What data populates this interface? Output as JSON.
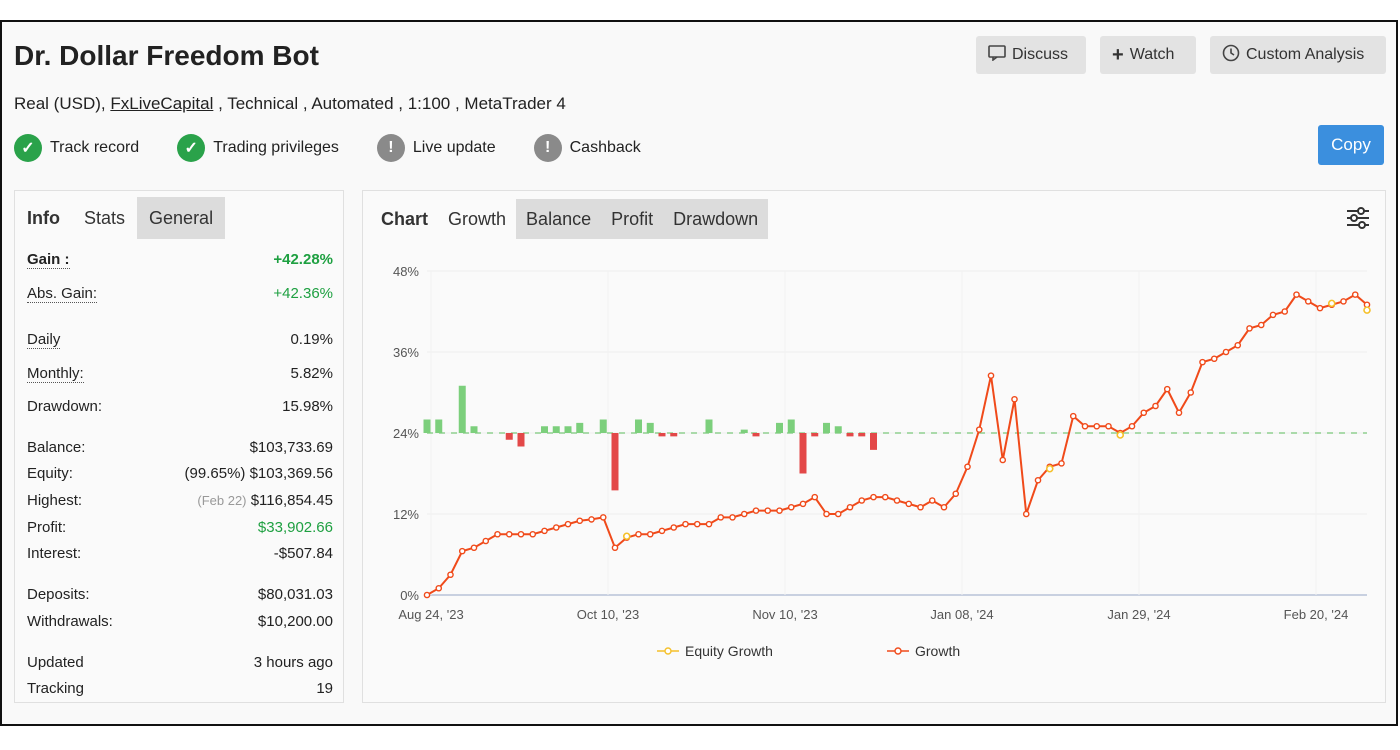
{
  "header": {
    "title": "Dr. Dollar Freedom Bot",
    "subtitle_prefix": "Real (USD), ",
    "subtitle_link": "FxLiveCapital",
    "subtitle_suffix": " , Technical , Automated , 1:100 , MetaTrader 4",
    "buttons": {
      "discuss": "Discuss",
      "watch": "Watch",
      "custom_analysis": "Custom Analysis",
      "copy": "Copy"
    }
  },
  "badges": [
    {
      "label": "Track record",
      "status": "ok"
    },
    {
      "label": "Trading privileges",
      "status": "ok"
    },
    {
      "label": "Live update",
      "status": "warn"
    },
    {
      "label": "Cashback",
      "status": "warn"
    }
  ],
  "left_panel": {
    "tabs": [
      "Info",
      "Stats",
      "General"
    ],
    "gain": {
      "label": "Gain :",
      "value": "+42.28%"
    },
    "abs_gain": {
      "label": "Abs. Gain:",
      "value": "+42.36%"
    },
    "daily": {
      "label": "Daily",
      "value": "0.19%"
    },
    "monthly": {
      "label": "Monthly:",
      "value": "5.82%"
    },
    "drawdown": {
      "label": "Drawdown:",
      "value": "15.98%"
    },
    "balance": {
      "label": "Balance:",
      "value": "$103,733.69"
    },
    "equity": {
      "label": "Equity:",
      "pct": "(99.65%)",
      "value": "$103,369.56"
    },
    "highest": {
      "label": "Highest:",
      "date": "(Feb 22)",
      "value": "$116,854.45"
    },
    "profit": {
      "label": "Profit:",
      "value": "$33,902.66"
    },
    "interest": {
      "label": "Interest:",
      "value": "-$507.84"
    },
    "deposits": {
      "label": "Deposits:",
      "value": "$80,031.03"
    },
    "withdrawals": {
      "label": "Withdrawals:",
      "value": "$10,200.00"
    },
    "updated": {
      "label": "Updated",
      "value": "3 hours ago"
    },
    "tracking": {
      "label": "Tracking",
      "value": "19"
    }
  },
  "chart_panel": {
    "tabs": [
      "Chart",
      "Growth",
      "Balance",
      "Profit",
      "Drawdown"
    ]
  },
  "colors": {
    "growth": "#f04a1a",
    "equity": "#f5c02a",
    "bar_pos": "#7ccf7c",
    "bar_neg": "#e34848",
    "copy": "#3b8fde",
    "green_text": "#1ea041"
  },
  "chart_data": {
    "type": "line",
    "ylim": [
      0,
      48
    ],
    "yticks": [
      "0%",
      "12%",
      "24%",
      "36%",
      "48%"
    ],
    "xticks": [
      "Aug 24, '23",
      "Oct 10, '23",
      "Nov 10, '23",
      "Jan 08, '24",
      "Jan 29, '24",
      "Feb 20, '24"
    ],
    "legend": [
      "Equity Growth",
      "Growth"
    ],
    "growth": [
      0,
      1,
      3,
      6.5,
      7,
      8,
      9,
      9,
      9,
      9,
      9.5,
      10,
      10.5,
      11,
      11.2,
      11.5,
      7,
      8.5,
      9,
      9,
      9.5,
      10,
      10.5,
      10.5,
      10.5,
      11.5,
      11.5,
      12,
      12.5,
      12.5,
      12.5,
      13,
      13.5,
      14.5,
      12,
      12,
      13,
      14,
      14.5,
      14.5,
      14,
      13.5,
      13,
      14,
      13,
      15,
      19,
      24.5,
      32.5,
      20,
      29,
      12,
      17,
      19,
      19.5,
      26.5,
      25,
      25,
      25,
      24,
      25,
      27,
      28,
      30.5,
      27,
      30,
      34.5,
      35,
      36,
      37,
      39.5,
      40,
      41.5,
      42,
      44.5,
      43.5,
      42.5,
      43,
      43.5,
      44.5,
      43
    ],
    "equity_points": [
      {
        "i": 17,
        "v": 9
      },
      {
        "i": 53,
        "v": 19
      },
      {
        "i": 59,
        "v": 24
      },
      {
        "i": 77,
        "v": 43.5
      },
      {
        "i": 80,
        "v": 42.5
      }
    ],
    "profit_bars": [
      2,
      2,
      0,
      7,
      1,
      0,
      0,
      -1,
      -2,
      0,
      1,
      1,
      1,
      1.5,
      0,
      2,
      -8.5,
      0,
      2,
      1.5,
      -0.5,
      -0.5,
      0,
      0,
      2,
      0,
      0,
      0.5,
      -0.5,
      0,
      1.5,
      2,
      -6,
      -0.5,
      1.5,
      1,
      -0.5,
      -0.5,
      -2.5,
      0,
      0,
      0,
      0,
      0,
      0,
      0,
      0,
      0,
      0,
      0,
      0,
      0,
      0,
      0,
      0,
      0,
      0,
      0,
      0,
      0,
      0,
      0,
      0,
      0,
      0,
      0,
      0,
      0,
      0,
      0,
      0,
      0,
      0,
      0,
      0,
      0,
      0,
      0,
      0,
      0,
      0
    ]
  }
}
